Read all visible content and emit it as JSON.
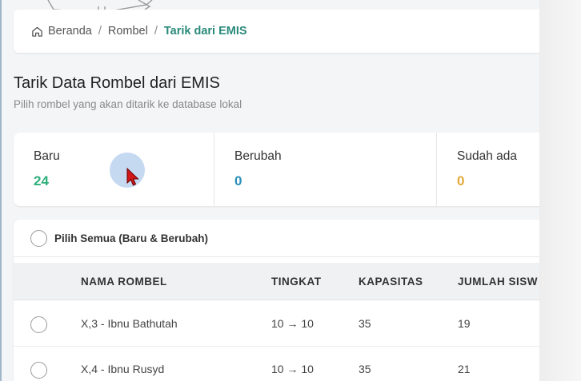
{
  "breadcrumb": {
    "home_icon": "home-icon",
    "items": [
      "Beranda",
      "Rombel",
      "Tarik dari EMIS"
    ],
    "separator": "/"
  },
  "page": {
    "title": "Tarik Data Rombel dari EMIS",
    "subtitle": "Pilih rombel yang akan ditarik ke database lokal"
  },
  "stats": [
    {
      "label": "Baru",
      "value": "24",
      "color": "#2fb07a"
    },
    {
      "label": "Berubah",
      "value": "0",
      "color": "#2a8fb8"
    },
    {
      "label": "Sudah ada",
      "value": "0",
      "color": "#e2a83a"
    }
  ],
  "table": {
    "select_all_label": "Pilih Semua (Baru & Berubah)",
    "headers": [
      "NAMA ROMBEL",
      "TINGKAT",
      "KAPASITAS",
      "JUMLAH SISW"
    ],
    "rows": [
      {
        "nama": "X,3 - Ibnu Bathutah",
        "tingkat": "10 → 10",
        "kapasitas": "35",
        "jumlah": "19"
      },
      {
        "nama": "X,4 - Ibnu Rusyd",
        "tingkat": "10 → 10",
        "kapasitas": "35",
        "jumlah": "21"
      }
    ]
  }
}
